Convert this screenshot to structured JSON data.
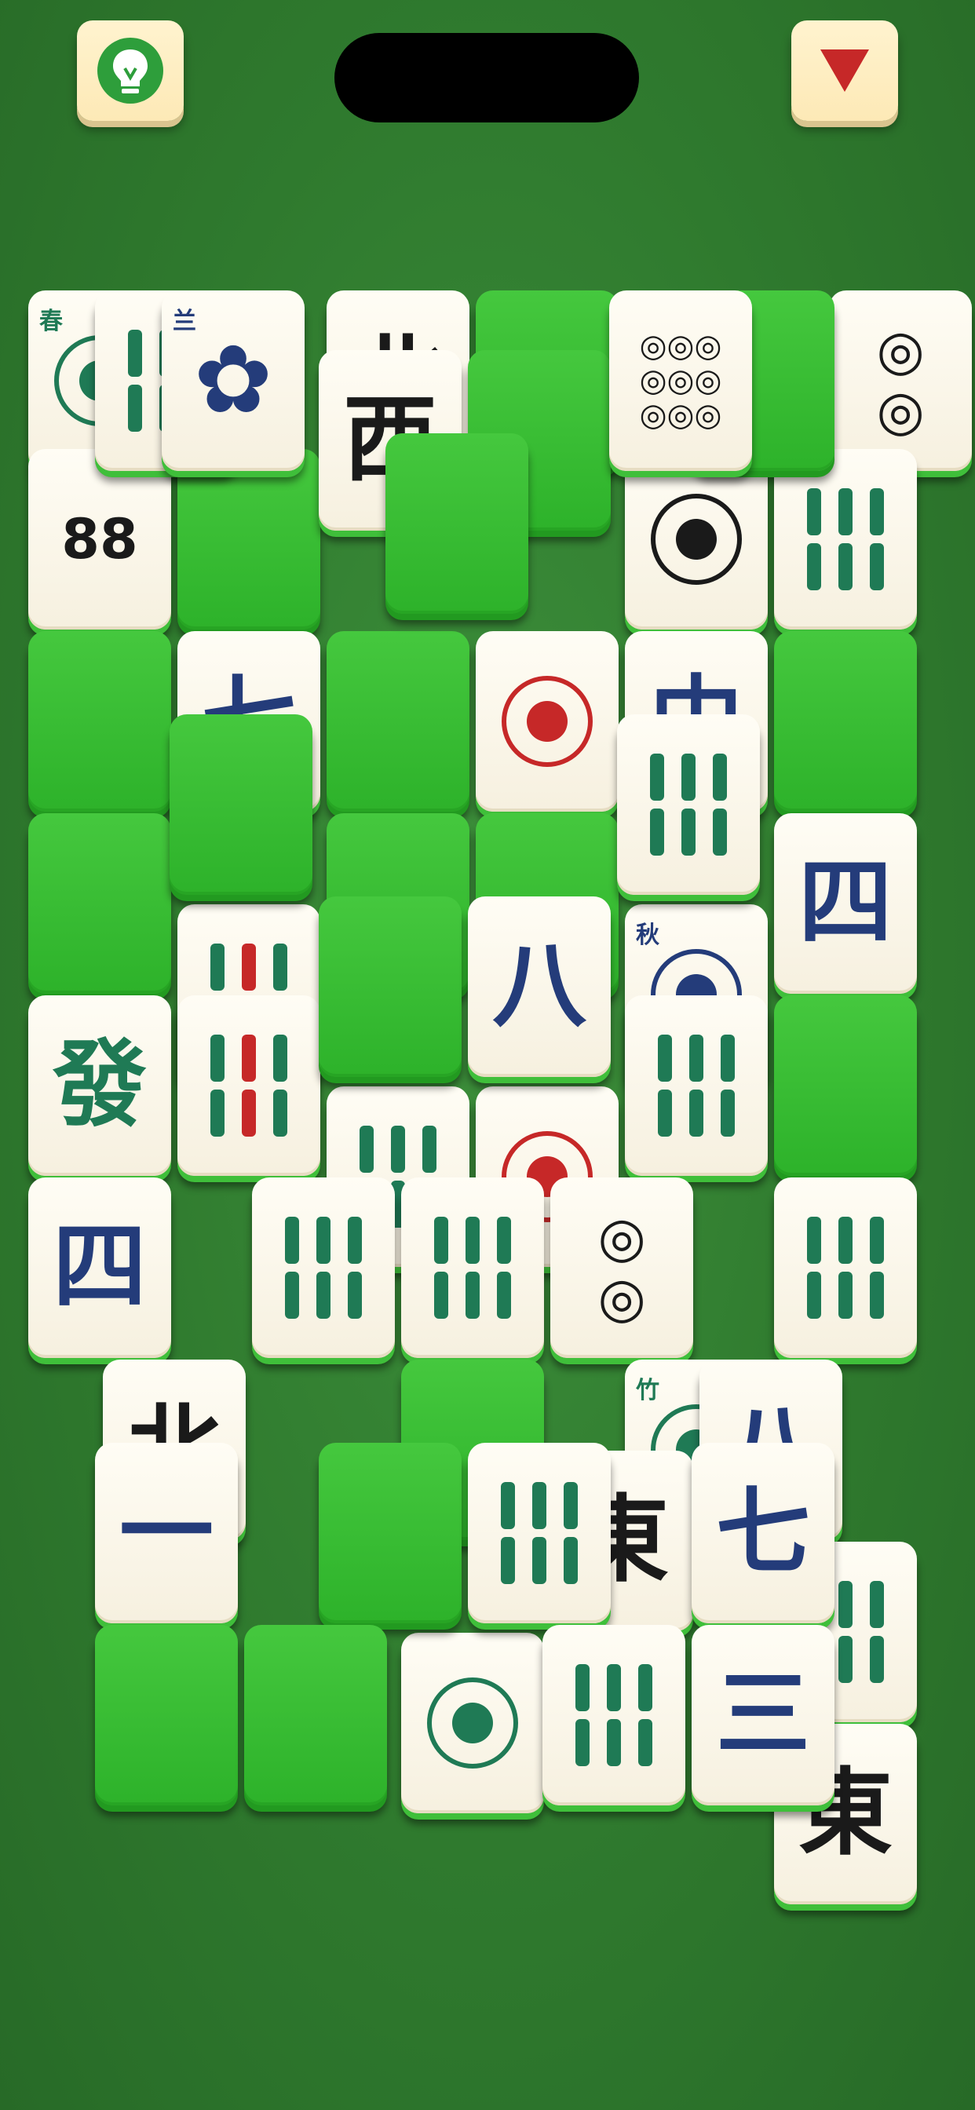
{
  "hint_button": {
    "icon": "lightbulb-icon",
    "color": "#2e9e3b"
  },
  "menu_button": {
    "icon": "triangle-down-icon",
    "color": "#c62828"
  },
  "colors": {
    "felt": "#2f7a2e",
    "tile_face": "#fbf7ea",
    "tile_back": "#36bb31",
    "blue": "#243c7a",
    "green": "#1f7a55",
    "red": "#c62828",
    "black": "#1a1a1a"
  },
  "tiles": [
    {
      "g": "",
      "c": "green",
      "z": 0,
      "type": "flower",
      "s": "春",
      "r": 2,
      "col": 0
    },
    {
      "g": "",
      "c": "green",
      "z": 1,
      "type": "bamboo-bird",
      "r": 2,
      "col": 1
    },
    {
      "g": "✿",
      "c": "blue",
      "z": 2,
      "type": "flower",
      "s": "兰",
      "r": 1,
      "col": 2
    },
    {
      "g": "北",
      "c": "black",
      "z": 0,
      "type": "wind",
      "r": 2,
      "col": 4
    },
    {
      "g": "",
      "c": "back",
      "z": 0,
      "type": "back",
      "r": 2,
      "col": 6
    },
    {
      "g": "西",
      "c": "black",
      "z": 1,
      "type": "wind",
      "r": 3,
      "col": 4
    },
    {
      "g": "",
      "c": "back",
      "z": 1,
      "type": "back",
      "r": 3,
      "col": 6
    },
    {
      "g": "",
      "c": "back",
      "z": 2,
      "type": "back",
      "r": 4,
      "col": 5
    },
    {
      "g": "",
      "c": "back",
      "z": 1,
      "type": "back",
      "r": 2,
      "col": 9
    },
    {
      "g": "◎◎◎\n◎◎◎\n◎◎◎",
      "c": "mixed",
      "z": 2,
      "type": "circle",
      "r": 1,
      "col": 8
    },
    {
      "g": "◎\n◎",
      "c": "mixed",
      "z": 0,
      "type": "circle",
      "r": 2,
      "col": 11
    },
    {
      "g": "88",
      "c": "black",
      "z": 0,
      "type": "circle",
      "r": 4,
      "col": 0
    },
    {
      "g": "",
      "c": "back",
      "z": 0,
      "type": "back",
      "r": 4,
      "col": 2
    },
    {
      "g": "",
      "c": "black",
      "z": 0,
      "type": "flower",
      "r": 4,
      "col": 8
    },
    {
      "g": "",
      "c": "green",
      "z": 0,
      "type": "bamboo",
      "r": 4,
      "col": 10
    },
    {
      "g": "",
      "c": "back",
      "z": 0,
      "type": "back",
      "r": 6,
      "col": 0
    },
    {
      "g": "七",
      "c": "blue",
      "z": 0,
      "type": "char",
      "r": 6,
      "col": 2
    },
    {
      "g": "",
      "c": "back",
      "z": 0,
      "type": "back",
      "r": 6,
      "col": 4
    },
    {
      "g": "",
      "c": "red",
      "z": 0,
      "type": "dragon",
      "r": 6,
      "col": 6
    },
    {
      "g": "中",
      "c": "blue",
      "z": 0,
      "type": "dragon",
      "r": 6,
      "col": 8
    },
    {
      "g": "",
      "c": "back",
      "z": 0,
      "type": "back",
      "r": 6,
      "col": 10
    },
    {
      "g": "",
      "c": "back",
      "z": 1,
      "type": "back",
      "r": 7,
      "col": 2
    },
    {
      "g": "",
      "c": "green",
      "z": 1,
      "type": "bamboo",
      "r": 7,
      "col": 8
    },
    {
      "g": "",
      "c": "back",
      "z": 0,
      "type": "back",
      "r": 8,
      "col": 0
    },
    {
      "g": "",
      "c": "mixed",
      "z": 0,
      "type": "bamboo",
      "r": 9,
      "col": 2
    },
    {
      "g": "",
      "c": "back",
      "z": 0,
      "type": "back",
      "r": 8,
      "col": 4
    },
    {
      "g": "",
      "c": "back",
      "z": 0,
      "type": "back",
      "r": 8,
      "col": 6
    },
    {
      "g": "",
      "c": "blue",
      "z": 0,
      "type": "flower",
      "s": "秋",
      "r": 9,
      "col": 8
    },
    {
      "g": "四",
      "c": "blue",
      "z": 0,
      "type": "char",
      "r": 8,
      "col": 10
    },
    {
      "g": "",
      "c": "back",
      "z": 1,
      "type": "back",
      "r": 9,
      "col": 4
    },
    {
      "g": "八",
      "c": "blue",
      "z": 1,
      "type": "char",
      "r": 9,
      "col": 6
    },
    {
      "g": "發",
      "c": "green",
      "z": 0,
      "type": "dragon",
      "r": 10,
      "col": 0
    },
    {
      "g": "",
      "c": "mixed",
      "z": 0,
      "type": "bamboo",
      "r": 10,
      "col": 2
    },
    {
      "g": "",
      "c": "green",
      "z": 0,
      "type": "bamboo",
      "r": 11,
      "col": 4
    },
    {
      "g": "",
      "c": "red",
      "z": 0,
      "type": "flower",
      "r": 11,
      "col": 6
    },
    {
      "g": "",
      "c": "green",
      "z": 0,
      "type": "bamboo",
      "r": 10,
      "col": 8
    },
    {
      "g": "",
      "c": "back",
      "z": 0,
      "type": "back",
      "r": 10,
      "col": 10
    },
    {
      "g": "四",
      "c": "blue",
      "z": 0,
      "type": "char",
      "r": 12,
      "col": 0
    },
    {
      "g": "",
      "c": "green",
      "z": 0,
      "type": "bamboo-bird",
      "r": 12,
      "col": 3
    },
    {
      "g": "",
      "c": "green",
      "z": 0,
      "type": "bamboo",
      "r": 12,
      "col": 5
    },
    {
      "g": "◎\n◎",
      "c": "mixed",
      "z": 0,
      "type": "circle",
      "r": 12,
      "col": 7
    },
    {
      "g": "",
      "c": "green",
      "z": 0,
      "type": "bamboo",
      "r": 12,
      "col": 10
    },
    {
      "g": "北",
      "c": "black",
      "z": 0,
      "type": "wind",
      "r": 14,
      "col": 1
    },
    {
      "g": "",
      "c": "back",
      "z": 0,
      "type": "back",
      "r": 14,
      "col": 5
    },
    {
      "g": "",
      "c": "green",
      "z": 0,
      "type": "flower",
      "s": "竹",
      "r": 14,
      "col": 8
    },
    {
      "g": "八",
      "c": "blue",
      "z": 0,
      "type": "char",
      "r": 14,
      "col": 9
    },
    {
      "g": "一",
      "c": "blue",
      "z": 1,
      "type": "char",
      "r": 15,
      "col": 1
    },
    {
      "g": "",
      "c": "back",
      "z": 1,
      "type": "back",
      "r": 15,
      "col": 4
    },
    {
      "g": "",
      "c": "green",
      "z": 1,
      "type": "bamboo",
      "r": 15,
      "col": 6
    },
    {
      "g": "東",
      "c": "black",
      "z": 0,
      "type": "wind",
      "r": 15,
      "col": 7
    },
    {
      "g": "七",
      "c": "blue",
      "z": 1,
      "type": "char",
      "r": 15,
      "col": 9
    },
    {
      "g": "",
      "c": "green",
      "z": 0,
      "type": "bamboo",
      "r": 16,
      "col": 10
    },
    {
      "g": "",
      "c": "green",
      "z": 0,
      "type": "flower",
      "r": 17,
      "col": 5
    },
    {
      "g": "",
      "c": "back",
      "z": 1,
      "type": "back",
      "r": 17,
      "col": 1
    },
    {
      "g": "",
      "c": "back",
      "z": 1,
      "type": "back",
      "r": 17,
      "col": 3
    },
    {
      "g": "",
      "c": "green",
      "z": 1,
      "type": "bamboo",
      "r": 17,
      "col": 7
    },
    {
      "g": "三",
      "c": "blue",
      "z": 1,
      "type": "char",
      "r": 17,
      "col": 9
    },
    {
      "g": "東",
      "c": "black",
      "z": 0,
      "type": "wind",
      "r": 18,
      "col": 10
    }
  ]
}
